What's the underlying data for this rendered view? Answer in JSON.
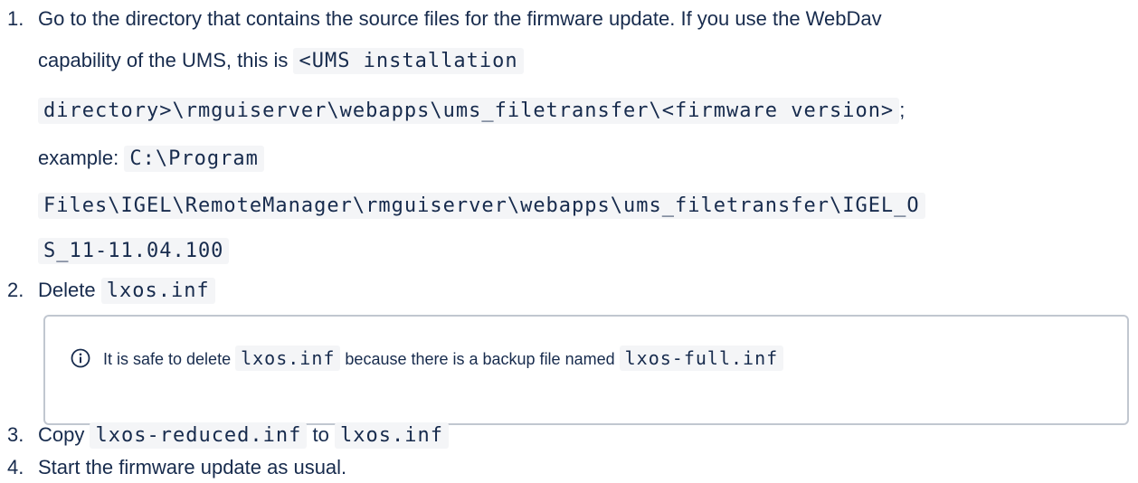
{
  "steps": [
    {
      "number": "1.",
      "line1": "Go to the directory that contains the source files for the firmware update. If you use the WebDav",
      "line2_text": "capability of the UMS, this is ",
      "line2_code": "<UMS installation",
      "line3_code": "directory>\\rmguiserver\\webapps\\ums_filetransfer\\<firmware version>",
      "line3_tail": ";",
      "line4_text": "example: ",
      "line4_code": "C:\\Program",
      "line5_code": "Files\\IGEL\\RemoteManager\\rmguiserver\\webapps\\ums_filetransfer\\IGEL_O",
      "line6_code": "S_11-11.04.100"
    },
    {
      "number": "2.",
      "text": "Delete ",
      "code": "lxos.inf"
    },
    {
      "number": "3.",
      "text": "Copy ",
      "code1": "lxos-reduced.inf",
      "mid": " to ",
      "code2": "lxos.inf"
    },
    {
      "number": "4.",
      "text": "Start the firmware update as usual."
    }
  ],
  "info_panel": {
    "icon": "info-icon",
    "text_before": "It is safe to delete ",
    "code1": "lxos.inf",
    "text_mid": " because there is a backup file named ",
    "code2": "lxos-full.inf"
  },
  "colors": {
    "text": "#172b4d",
    "code_bg": "#f4f5f7",
    "panel_border": "#c1c7d0"
  }
}
